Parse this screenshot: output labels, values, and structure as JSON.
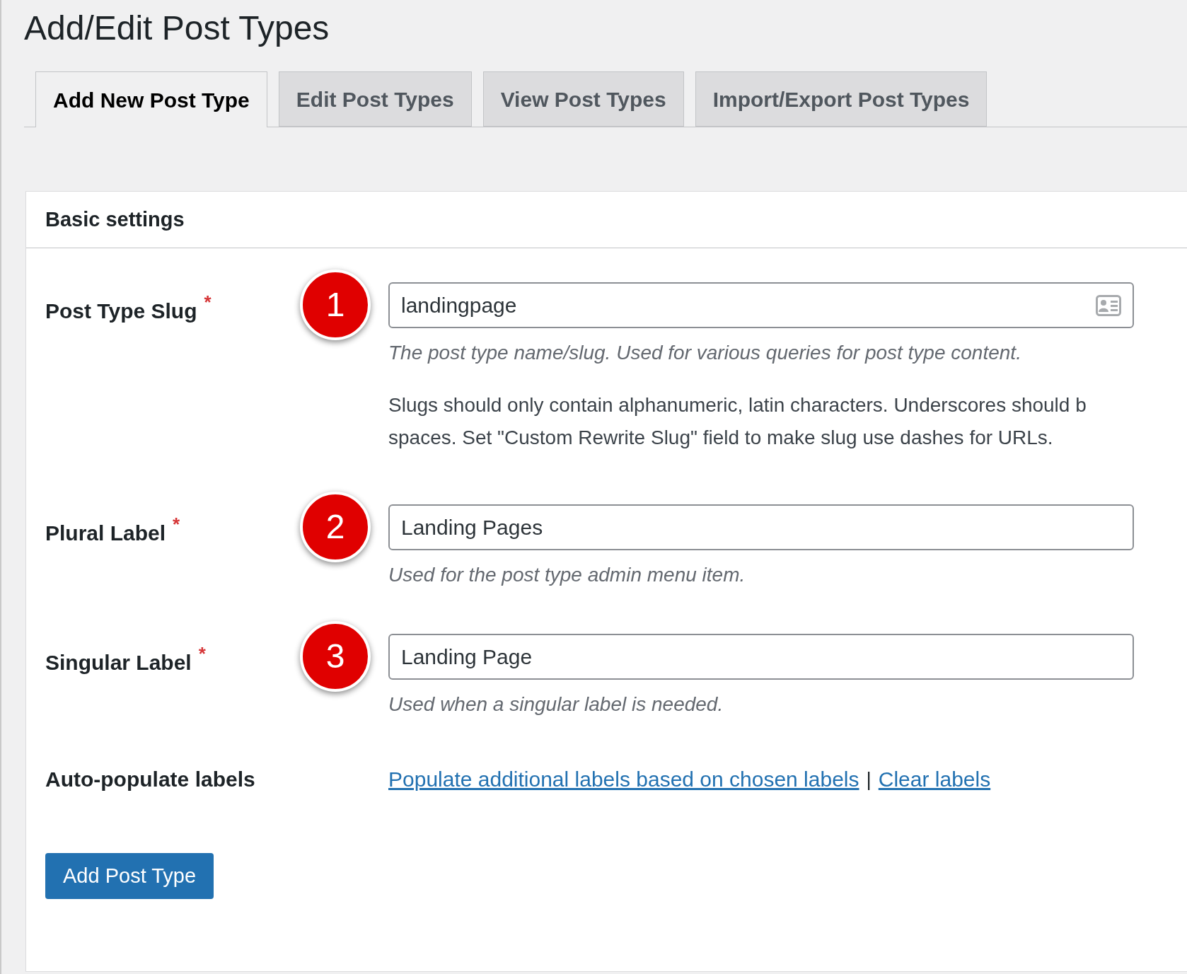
{
  "page_title": "Add/Edit Post Types",
  "tabs": [
    {
      "label": "Add New Post Type",
      "selected": true
    },
    {
      "label": "Edit Post Types",
      "selected": false
    },
    {
      "label": "View Post Types",
      "selected": false
    },
    {
      "label": "Import/Export Post Types",
      "selected": false
    }
  ],
  "section": {
    "title": "Basic settings"
  },
  "fields": [
    {
      "label": "Post Type Slug",
      "required_mark": "*",
      "badge": "1",
      "value": "landingpage",
      "has_icon": true,
      "description": "The post type name/slug. Used for various queries for post type content.",
      "notes": [
        "Slugs should only contain alphanumeric, latin characters. Underscores should b",
        "spaces. Set \"Custom Rewrite Slug\" field to make slug use dashes for URLs."
      ]
    },
    {
      "label": "Plural Label",
      "required_mark": "*",
      "badge": "2",
      "value": "Landing Pages",
      "has_icon": false,
      "description": "Used for the post type admin menu item."
    },
    {
      "label": "Singular Label",
      "required_mark": "*",
      "badge": "3",
      "value": "Landing Page",
      "has_icon": false,
      "description": "Used when a singular label is needed."
    }
  ],
  "auto_populate": {
    "label": "Auto-populate labels",
    "links": [
      "Populate additional labels based on chosen labels",
      "Clear labels"
    ],
    "separator": "|"
  },
  "submit_button": "Add Post Type"
}
